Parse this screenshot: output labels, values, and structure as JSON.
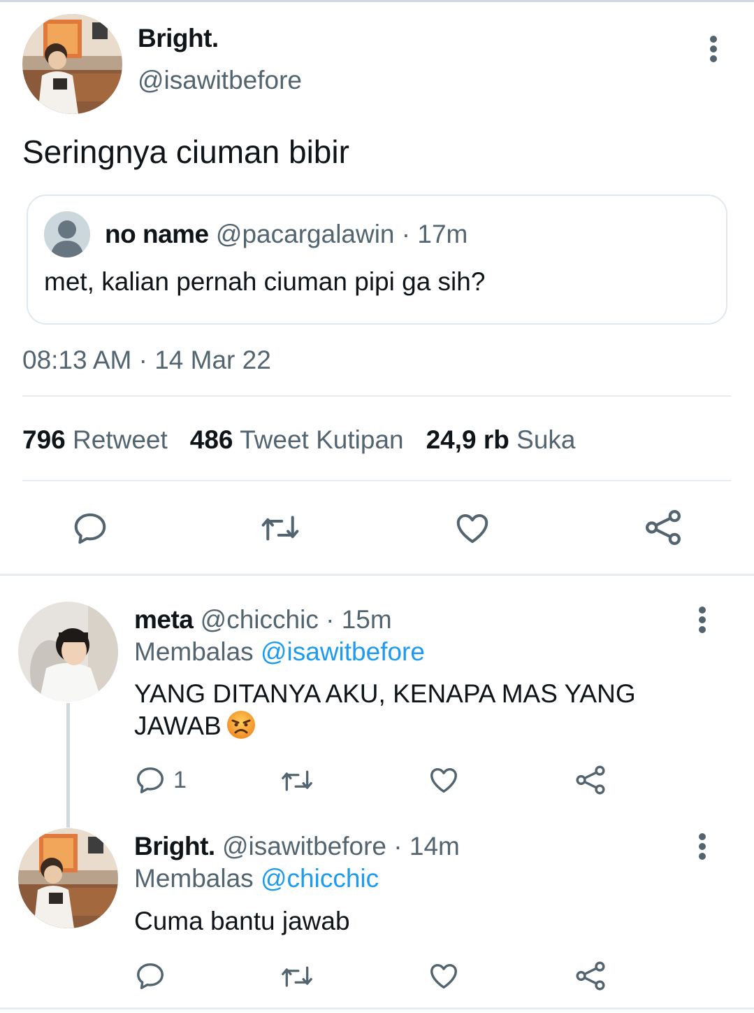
{
  "main_tweet": {
    "author_name": "Bright.",
    "author_handle": "@isawitbefore",
    "text": "Seringnya ciuman bibir",
    "quote": {
      "name": "no name",
      "handle": "@pacargalawin",
      "separator": "·",
      "time": "17m",
      "text": "met, kalian pernah ciuman pipi ga sih?"
    },
    "timestamp": "08:13 AM · 14 Mar 22",
    "stats": {
      "retweets_count": "796",
      "retweets_label": "Retweet",
      "quotes_count": "486",
      "quotes_label": "Tweet Kutipan",
      "likes_count": "24,9 rb",
      "likes_label": "Suka"
    },
    "actions": [
      "reply-icon",
      "retweet-icon",
      "like-icon",
      "share-icon"
    ]
  },
  "replies": [
    {
      "name": "meta",
      "handle": "@chicchic",
      "separator": "·",
      "time": "15m",
      "replying_label": "Membalas",
      "replying_to": "@isawitbefore",
      "text_line1": "YANG DITANYA AKU, KENAPA MAS YANG",
      "text_line2": "JAWAB",
      "emoji": "angry-face-emoji",
      "reply_count": "1"
    },
    {
      "name": "Bright.",
      "handle": "@isawitbefore",
      "separator": "·",
      "time": "14m",
      "replying_label": "Membalas",
      "replying_to": "@chicchic",
      "text": "Cuma bantu jawab"
    }
  ],
  "colors": {
    "primary_text": "#0f1419",
    "secondary_text": "#536471",
    "link": "#1d9bf0",
    "border": "#e1e8ed"
  }
}
